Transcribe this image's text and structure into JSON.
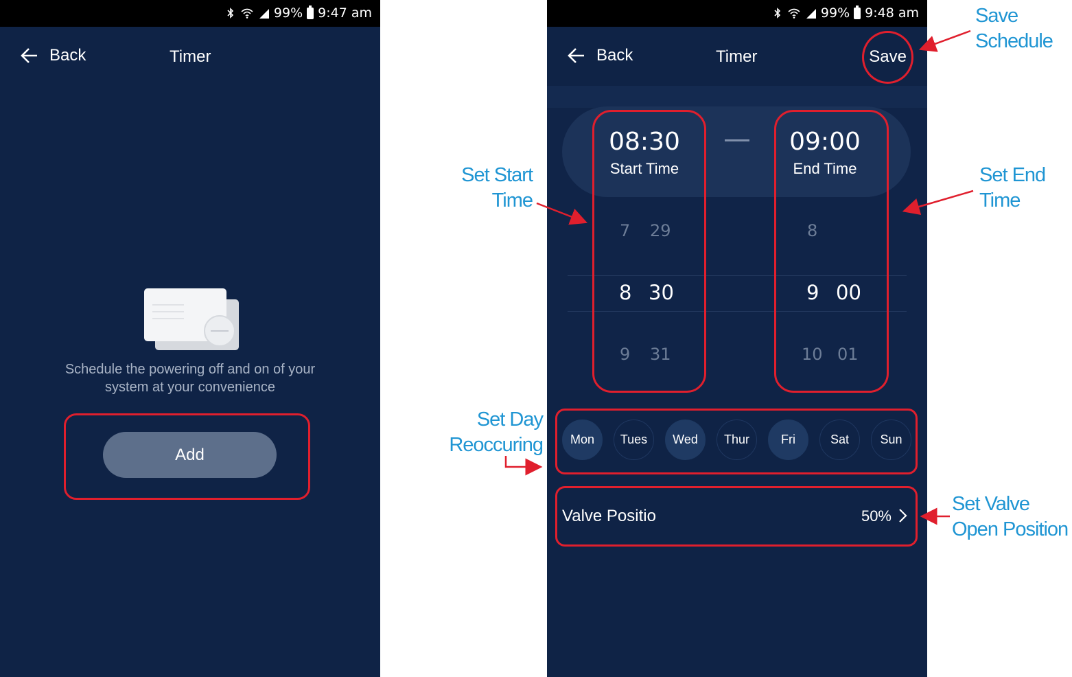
{
  "screen_left": {
    "status": {
      "percent": "99%",
      "time": "9:47 am"
    },
    "nav": {
      "back_label": "Back",
      "title": "Timer"
    },
    "empty_state": {
      "description_line1": "Schedule the powering off and on of your",
      "description_line2": "system at your convenience"
    },
    "add_label": "Add"
  },
  "screen_right": {
    "status": {
      "percent": "99%",
      "time": "9:48 am"
    },
    "nav": {
      "back_label": "Back",
      "title": "Timer",
      "save_label": "Save"
    },
    "start": {
      "value": "08:30",
      "label": "Start Time",
      "wheel_hours": [
        "7",
        "8",
        "9"
      ],
      "wheel_minutes": [
        "29",
        "30",
        "31"
      ]
    },
    "end": {
      "value": "09:00",
      "label": "End Time",
      "wheel_hours": [
        "8",
        "9",
        "10"
      ],
      "wheel_minutes": [
        "",
        "00",
        "01"
      ]
    },
    "days": [
      {
        "label": "Mon",
        "active": true
      },
      {
        "label": "Tues",
        "active": false
      },
      {
        "label": "Wed",
        "active": true
      },
      {
        "label": "Thur",
        "active": false
      },
      {
        "label": "Fri",
        "active": true
      },
      {
        "label": "Sat",
        "active": false
      },
      {
        "label": "Sun",
        "active": false
      }
    ],
    "valve": {
      "label": "Valve Positio",
      "value": "50%"
    }
  },
  "annotations": {
    "save_schedule": [
      "Save",
      "Schedule"
    ],
    "set_start_time": [
      "Set Start",
      "Time"
    ],
    "set_end_time": [
      "Set End",
      "Time"
    ],
    "set_day": [
      "Set Day",
      "Reoccuring"
    ],
    "set_valve": [
      "Set Valve",
      "Open Position"
    ]
  },
  "colors": {
    "background": "#0f2346",
    "annotation_red": "#e01f2d",
    "annotation_blue": "#1f95d3"
  }
}
